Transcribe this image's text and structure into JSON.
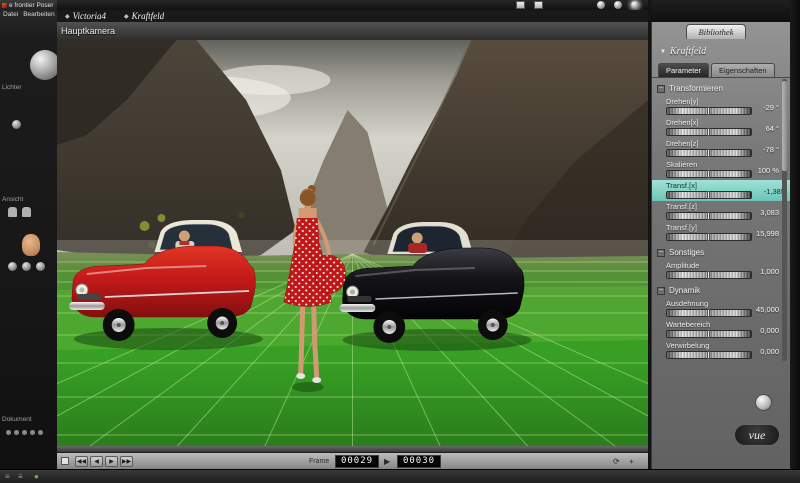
{
  "window": {
    "title": "e frontier Poser",
    "menus": [
      "Datei",
      "Bearbeiten"
    ]
  },
  "left_toolbar": {
    "sections": [
      {
        "label": "Lichter"
      },
      {
        "label": "Ansicht"
      },
      {
        "label": "Dokument"
      }
    ]
  },
  "top_bar": {
    "breadcrumb": [
      {
        "label": "Victoria4"
      },
      {
        "label": "Kraftfeld"
      }
    ]
  },
  "viewport": {
    "camera_label": "Hauptkamera"
  },
  "right_panel": {
    "library_tab": "Bibliothek",
    "title": "Kraftfeld",
    "tabs": [
      {
        "label": "Parameter",
        "active": true
      },
      {
        "label": "Eigenschaften",
        "active": false
      }
    ],
    "groups": [
      {
        "title": "Transformieren",
        "params": [
          {
            "label": "Drehen[y]",
            "value": "-29 °",
            "selected": false
          },
          {
            "label": "Drehen[x]",
            "value": "64 °",
            "selected": false
          },
          {
            "label": "Drehen[z]",
            "value": "-78 °",
            "selected": false
          },
          {
            "label": "Skalieren",
            "value": "100 %",
            "selected": false
          },
          {
            "label": "Transf.[x]",
            "value": "-1,385",
            "selected": true
          },
          {
            "label": "Transf.[z]",
            "value": "3,083",
            "selected": false
          },
          {
            "label": "Transf.[y]",
            "value": "15,998",
            "selected": false
          }
        ]
      },
      {
        "title": "Sonstiges",
        "params": [
          {
            "label": "Amplitude",
            "value": "1,000",
            "selected": false
          }
        ]
      },
      {
        "title": "Dynamik",
        "params": [
          {
            "label": "Ausdehnung",
            "value": "45,000",
            "selected": false
          },
          {
            "label": "Wartebereich",
            "value": "0,000",
            "selected": false
          },
          {
            "label": "Verwirbelung",
            "value": "0,000",
            "selected": false
          }
        ]
      }
    ],
    "vue_label": "vue"
  },
  "timeline": {
    "frame_label": "Frame",
    "current_frame": "00029",
    "end_frame": "00030"
  },
  "icons": {
    "diamond": "◆",
    "dropdown": "▼",
    "collapse": "−",
    "rew2": "◀◀",
    "rew": "◀",
    "play": "▶",
    "fwd": "▶▶",
    "loop": "⟳",
    "plus": "+",
    "menu": "≡",
    "dot": "●"
  },
  "colors": {
    "selected_row": "#7fcfc4",
    "grass_green": "#37a024",
    "car_red": "#c01818",
    "car_black": "#0a0a0c",
    "dress_red": "#c01818"
  }
}
